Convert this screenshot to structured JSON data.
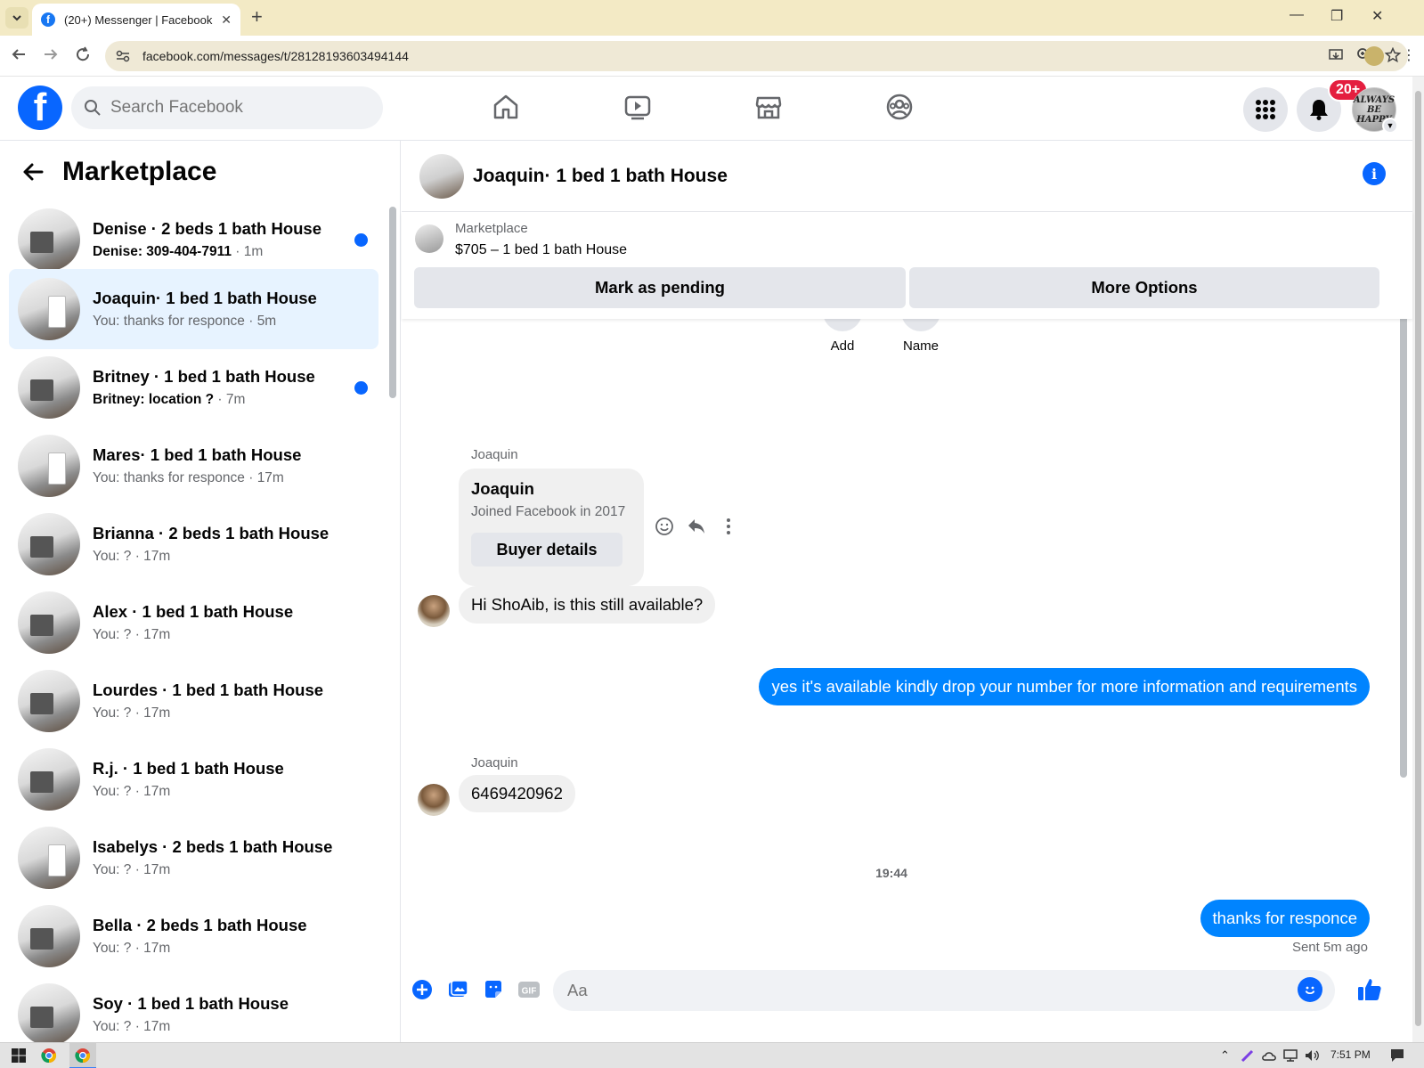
{
  "browser": {
    "tab_title": "(20+) Messenger | Facebook",
    "url": "facebook.com/messages/t/28128193603494144",
    "favicon_icon": "facebook-icon"
  },
  "header": {
    "logo": "f",
    "search_placeholder": "Search Facebook",
    "notification_badge": "20+",
    "profile_text": "ALWAYS BE HAPPY"
  },
  "sidebar": {
    "title": "Marketplace",
    "conversations": [
      {
        "name": "Denise · 2 beds 1 bath House",
        "preview": "Denise: 309-404-7911",
        "time": "1m",
        "unread": true
      },
      {
        "name": "Joaquin· 1 bed 1 bath House",
        "preview": "You: thanks for responce",
        "time": "5m",
        "unread": false,
        "active": true
      },
      {
        "name": "Britney · 1 bed 1 bath House",
        "preview": "Britney: location ?",
        "time": "7m",
        "unread": true
      },
      {
        "name": "Mares· 1 bed 1 bath House",
        "preview": "You: thanks for responce",
        "time": "17m",
        "unread": false
      },
      {
        "name": "Brianna · 2 beds 1 bath House",
        "preview": "You: ?",
        "time": "17m",
        "unread": false
      },
      {
        "name": "Alex · 1 bed 1 bath House",
        "preview": "You: ?",
        "time": "17m",
        "unread": false
      },
      {
        "name": "Lourdes · 1 bed 1 bath House",
        "preview": "You: ?",
        "time": "17m",
        "unread": false
      },
      {
        "name": "R.j. · 1 bed 1 bath House",
        "preview": "You: ?",
        "time": "17m",
        "unread": false
      },
      {
        "name": "Isabelys · 2 beds 1 bath House",
        "preview": "You: ?",
        "time": "17m",
        "unread": false
      },
      {
        "name": "Bella · 2 beds 1 bath House",
        "preview": "You: ?",
        "time": "17m",
        "unread": false
      },
      {
        "name": "Soy · 1 bed 1 bath House",
        "preview": "You: ?",
        "time": "17m",
        "unread": false
      }
    ]
  },
  "chat": {
    "title": "Joaquin· 1 bed 1 bath House",
    "marketplace_label": "Marketplace",
    "listing": "$705 – 1 bed 1 bath House",
    "mark_pending": "Mark as pending",
    "more_options": "More Options",
    "quick_actions": [
      "Add",
      "Name"
    ],
    "card": {
      "sender": "Joaquin",
      "name": "Joaquin",
      "joined": "Joined Facebook in 2017",
      "button": "Buyer details"
    },
    "messages": [
      {
        "from": "them",
        "text": "Hi ShoAib, is this still available?"
      },
      {
        "from": "me",
        "text": "yes it's available kindly drop your number for more information and requirements"
      },
      {
        "from": "them",
        "sender": "Joaquin",
        "text": "6469420962"
      },
      {
        "divider": "19:44"
      },
      {
        "from": "me",
        "text": "thanks for responce",
        "status": "Sent 5m ago"
      }
    ],
    "composer_placeholder": "Aa"
  },
  "taskbar": {
    "time": "7:51 PM"
  },
  "colors": {
    "fb_blue": "#0866ff",
    "outgoing_bubble": "#0084ff",
    "badge_red": "#e41e3f",
    "active_row": "#e7f3ff"
  }
}
